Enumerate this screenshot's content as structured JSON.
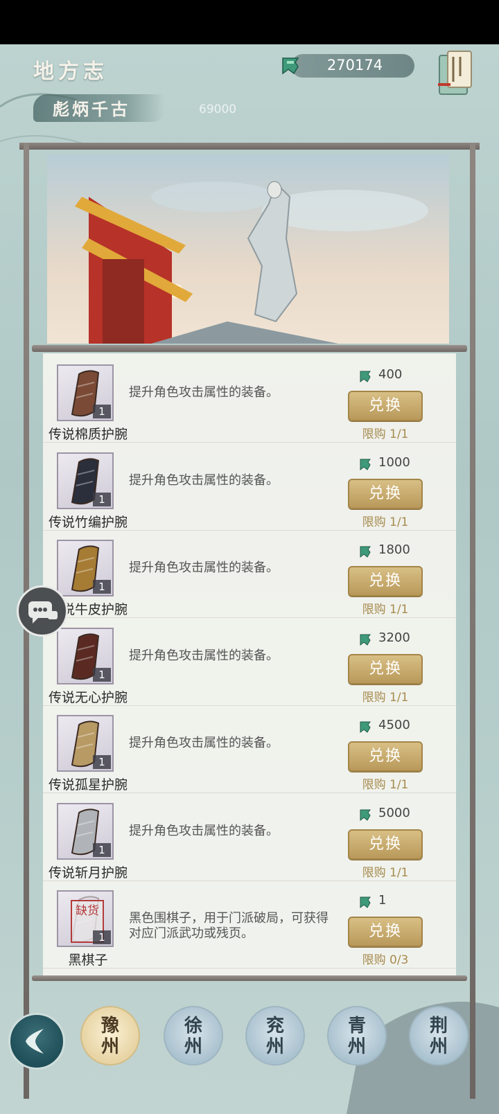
{
  "header": {
    "title": "地方志",
    "subtitle": "彪炳千古",
    "subtitle_value": "69000",
    "currency_amount": "270174"
  },
  "icons": {
    "currency": "jade-token-icon",
    "shop_list": "shopping-scroll-icon",
    "chat": "chat-bubble-icon",
    "back": "back-arrow-icon"
  },
  "shop_items": [
    {
      "name": "传说棉质护腕",
      "desc": "提升角色攻击属性的装备。",
      "qty": "1",
      "price": "400",
      "button": "兑换",
      "limit": "限购 1/1",
      "color": "#7a4a36"
    },
    {
      "name": "传说竹编护腕",
      "desc": "提升角色攻击属性的装备。",
      "qty": "1",
      "price": "1000",
      "button": "兑换",
      "limit": "限购 1/1",
      "color": "#2b2f3c"
    },
    {
      "name": "传说牛皮护腕",
      "desc": "提升角色攻击属性的装备。",
      "qty": "1",
      "price": "1800",
      "button": "兑换",
      "limit": "限购 1/1",
      "color": "#a67b34"
    },
    {
      "name": "传说无心护腕",
      "desc": "提升角色攻击属性的装备。",
      "qty": "1",
      "price": "3200",
      "button": "兑换",
      "limit": "限购 1/1",
      "color": "#5a2a22"
    },
    {
      "name": "传说孤星护腕",
      "desc": "提升角色攻击属性的装备。",
      "qty": "1",
      "price": "4500",
      "button": "兑换",
      "limit": "限购 1/1",
      "color": "#b89a65"
    },
    {
      "name": "传说斩月护腕",
      "desc": "提升角色攻击属性的装备。",
      "qty": "1",
      "price": "5000",
      "button": "兑换",
      "limit": "限购 1/1",
      "color": "#b0b4b8"
    },
    {
      "name": "黑棋子",
      "desc": "黑色围棋子，用于门派破局，可获得对应门派武功或残页。",
      "qty": "1",
      "price": "1",
      "button": "兑换",
      "limit": "限购 0/3",
      "color": "#d8d4dc",
      "stock_badge": "缺货"
    }
  ],
  "region_tabs": [
    {
      "label": "豫\n州",
      "active": true
    },
    {
      "label": "徐\n州",
      "active": false
    },
    {
      "label": "兖\n州",
      "active": false
    },
    {
      "label": "青\n州",
      "active": false
    },
    {
      "label": "荆\n州",
      "active": false
    }
  ],
  "colors": {
    "accent_gold": "#b8995a",
    "limit_text": "#a68b4e",
    "active_tab": "#e7d3a3"
  }
}
